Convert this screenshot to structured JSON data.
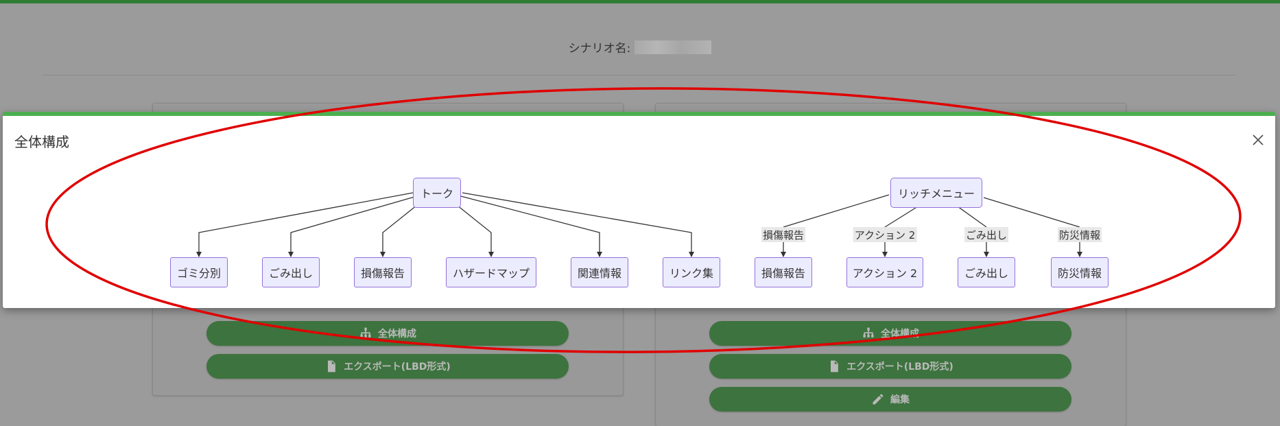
{
  "background": {
    "scenario_label": "シナリオ名:",
    "left_card": {
      "buttons": [
        {
          "label": "全体構成",
          "icon": "sitemap-icon"
        },
        {
          "label": "エクスポート(LBD形式)",
          "icon": "file-export-icon"
        }
      ]
    },
    "right_card": {
      "buttons": [
        {
          "label": "全体構成",
          "icon": "sitemap-icon"
        },
        {
          "label": "エクスポート(LBD形式)",
          "icon": "file-export-icon"
        },
        {
          "label": "編集",
          "icon": "pencil-icon"
        }
      ]
    }
  },
  "modal": {
    "title": "全体構成",
    "close_icon": "close-icon",
    "diagram": {
      "tree1": {
        "root": "トーク",
        "children": [
          "ゴミ分別",
          "ごみ出し",
          "損傷報告",
          "ハザードマップ",
          "関連情報",
          "リンク集"
        ]
      },
      "tree2": {
        "root": "リッチメニュー",
        "edges": [
          {
            "label": "損傷報告",
            "target": "損傷報告"
          },
          {
            "label": "アクション 2",
            "target": "アクション 2"
          },
          {
            "label": "ごみ出し",
            "target": "ごみ出し"
          },
          {
            "label": "防災情報",
            "target": "防災情報"
          }
        ]
      }
    }
  },
  "colors": {
    "accent_green": "#4caf50",
    "button_green": "#3d733e",
    "node_fill": "#ececff",
    "node_border": "#9370db",
    "annotation_red": "#e00000"
  }
}
